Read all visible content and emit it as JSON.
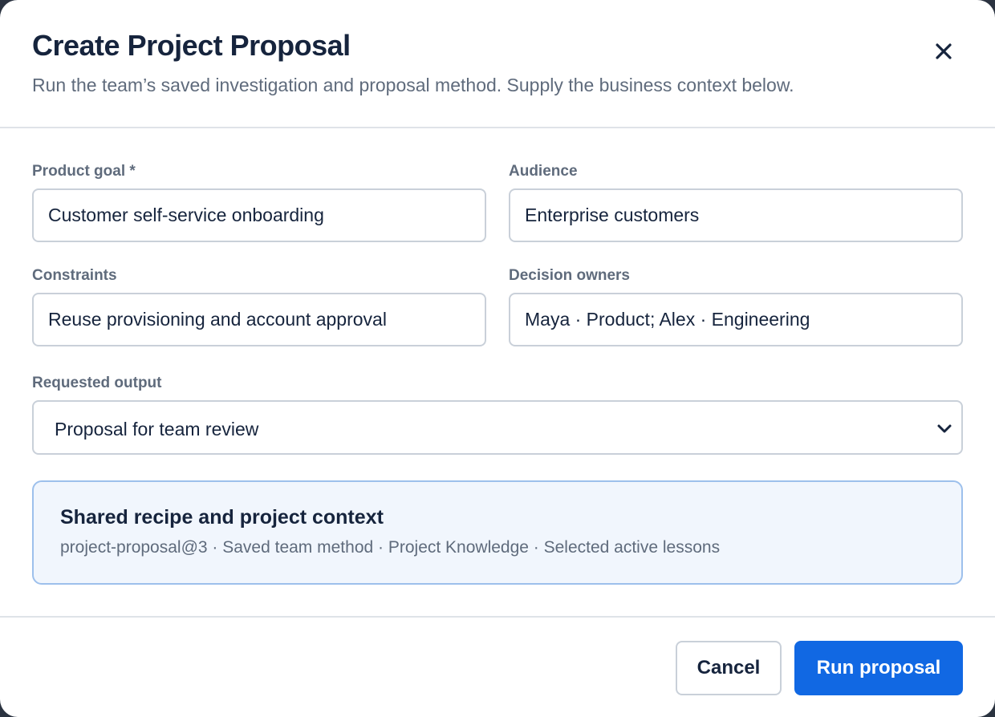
{
  "dialog": {
    "title": "Create Project Proposal",
    "subtitle": "Run the team’s saved investigation and proposal method. Supply the business context below.",
    "close_icon": "close-icon"
  },
  "form": {
    "product_goal": {
      "label": "Product goal *",
      "value": "Customer self-service onboarding"
    },
    "audience": {
      "label": "Audience",
      "value": "Enterprise customers"
    },
    "constraints": {
      "label": "Constraints",
      "value": "Reuse provisioning and account approval"
    },
    "decision_owners": {
      "label": "Decision owners",
      "value": "Maya · Product; Alex · Engineering"
    },
    "requested_output": {
      "label": "Requested output",
      "value": "Proposal for team review",
      "icon": "chevron-down-icon"
    }
  },
  "context_card": {
    "title": "Shared recipe and project context",
    "meta": "project-proposal@3 · Saved team method · Project Knowledge · Selected active lessons"
  },
  "footer": {
    "cancel_label": "Cancel",
    "run_label": "Run proposal"
  },
  "colors": {
    "primary": "#1168e3",
    "title_text": "#16243d",
    "muted_text": "#5f6b7c",
    "card_bg": "#f1f6fd",
    "card_border": "#9dc0ec"
  }
}
